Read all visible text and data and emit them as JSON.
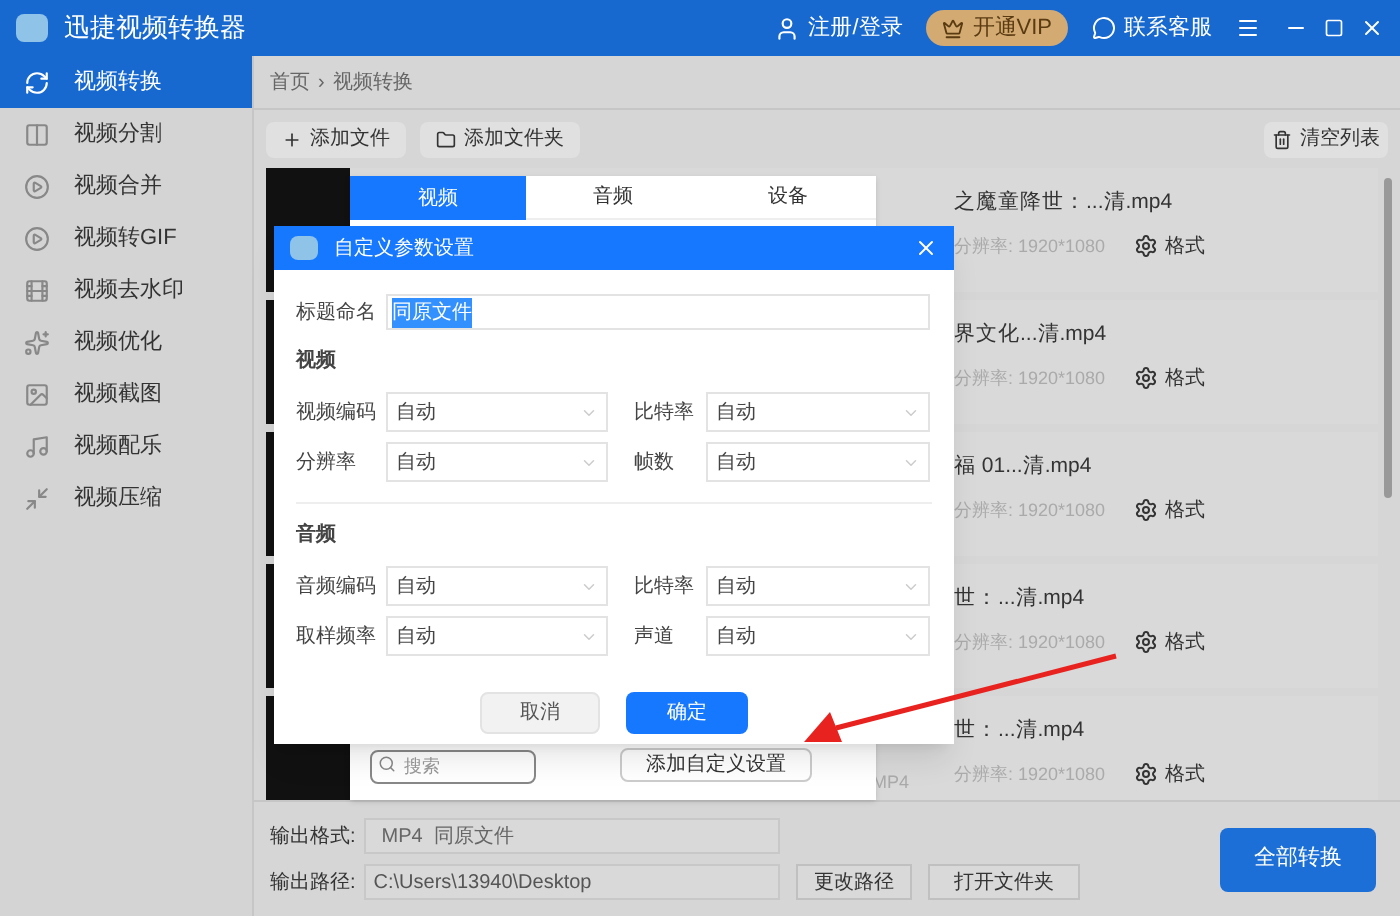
{
  "window": {
    "title": "迅捷视频转换器",
    "login": "注册/登录",
    "vip": "开通VIP",
    "support": "联系客服"
  },
  "sidebar": {
    "items": [
      {
        "label": "视频转换",
        "selected": true
      },
      {
        "label": "视频分割",
        "selected": false
      },
      {
        "label": "视频合并",
        "selected": false
      },
      {
        "label": "视频转GIF",
        "selected": false
      },
      {
        "label": "视频去水印",
        "selected": false
      },
      {
        "label": "视频优化",
        "selected": false
      },
      {
        "label": "视频截图",
        "selected": false
      },
      {
        "label": "视频配乐",
        "selected": false
      },
      {
        "label": "视频压缩",
        "selected": false
      }
    ]
  },
  "breadcrumb": [
    "首页",
    "›",
    "视频转换"
  ],
  "toolbar": {
    "add_file": "添加文件",
    "add_folder": "添加文件夹",
    "clear": "清空列表"
  },
  "files": [
    {
      "name": "之魔童降世：...清.mp4",
      "resolution": "分辨率: 1920*1080",
      "format_button": "格式"
    },
    {
      "name": "界文化...清.mp4",
      "resolution": "分辨率: 1920*1080",
      "format_button": "格式"
    },
    {
      "name": "福 01...清.mp4",
      "resolution": "分辨率: 1920*1080",
      "format_button": "格式"
    },
    {
      "name": "世：...清.mp4",
      "resolution": "分辨率: 1920*1080",
      "format_button": "格式"
    },
    {
      "name": "世：...清.mp4",
      "format": "MP4",
      "resolution": "分辨率: 1920*1080",
      "format_button": "格式"
    }
  ],
  "format_popup": {
    "tabs": [
      {
        "label": "视频",
        "selected": true
      },
      {
        "label": "音频",
        "selected": false
      },
      {
        "label": "设备",
        "selected": false
      }
    ],
    "search": {
      "placeholder": "搜索"
    },
    "add_custom": "添加自定义设置"
  },
  "dialog": {
    "title": "自定义参数设置",
    "name_label": "标题命名",
    "name_value": "同原文件",
    "name_selected": true,
    "sections": [
      {
        "heading": "视频",
        "fields": [
          {
            "label": "视频编码",
            "value": "自动"
          },
          {
            "label": "比特率",
            "value": "自动"
          },
          {
            "label": "分辨率",
            "value": "自动"
          },
          {
            "label": "帧数",
            "value": "自动"
          }
        ]
      },
      {
        "heading": "音频",
        "fields": [
          {
            "label": "音频编码",
            "value": "自动"
          },
          {
            "label": "比特率",
            "value": "自动"
          },
          {
            "label": "取样频率",
            "value": "自动"
          },
          {
            "label": "声道",
            "value": "自动"
          }
        ]
      }
    ],
    "cancel": "取消",
    "ok": "确定"
  },
  "output": {
    "format_label": "输出格式:",
    "format_value": "MP4  同原文件",
    "path_label": "输出路径:",
    "path_value": "C:\\Users\\13940\\Desktop",
    "change_path": "更改路径",
    "open_folder": "打开文件夹",
    "convert_all": "全部转换"
  }
}
